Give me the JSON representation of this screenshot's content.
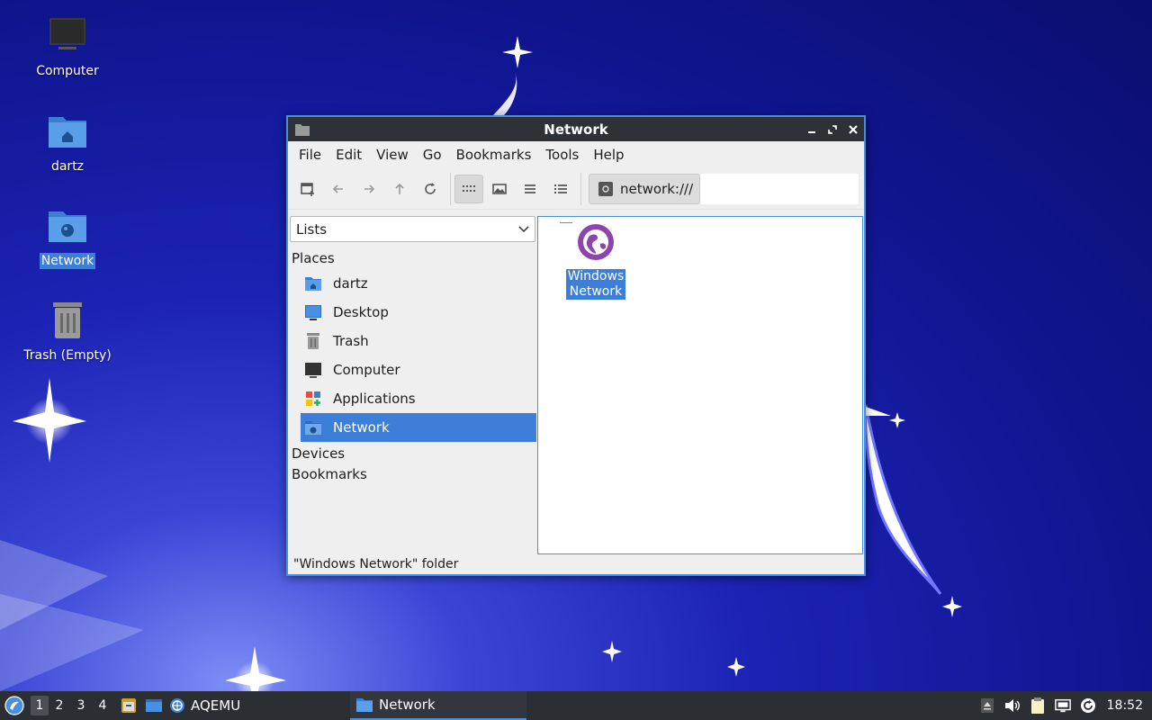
{
  "desktop": {
    "icons": [
      {
        "label": "Computer"
      },
      {
        "label": "dartz"
      },
      {
        "label": "Network"
      },
      {
        "label": "Trash (Empty)"
      }
    ]
  },
  "window": {
    "title": "Network",
    "menu": [
      "File",
      "Edit",
      "View",
      "Go",
      "Bookmarks",
      "Tools",
      "Help"
    ],
    "address": "network:///",
    "sidebar": {
      "select_value": "Lists",
      "sections": {
        "places": "Places",
        "devices": "Devices",
        "bookmarks": "Bookmarks"
      },
      "places": [
        {
          "label": "dartz",
          "icon": "home-folder-icon"
        },
        {
          "label": "Desktop",
          "icon": "desktop-icon"
        },
        {
          "label": "Trash",
          "icon": "trash-icon"
        },
        {
          "label": "Computer",
          "icon": "computer-icon"
        },
        {
          "label": "Applications",
          "icon": "applications-icon"
        },
        {
          "label": "Network",
          "icon": "network-icon"
        }
      ]
    },
    "files": [
      {
        "label_line1": "Windows",
        "label_line2": "Network"
      }
    ],
    "status": "\"Windows Network\" folder"
  },
  "taskbar": {
    "workspaces": [
      "1",
      "2",
      "3",
      "4"
    ],
    "tasks": [
      {
        "label": "AQEMU"
      },
      {
        "label": "Network"
      }
    ],
    "clock": "18:52"
  },
  "colors": {
    "accent": "#3d7fd8",
    "titlebar": "#2e3136",
    "taskbar": "#2b2e33"
  }
}
